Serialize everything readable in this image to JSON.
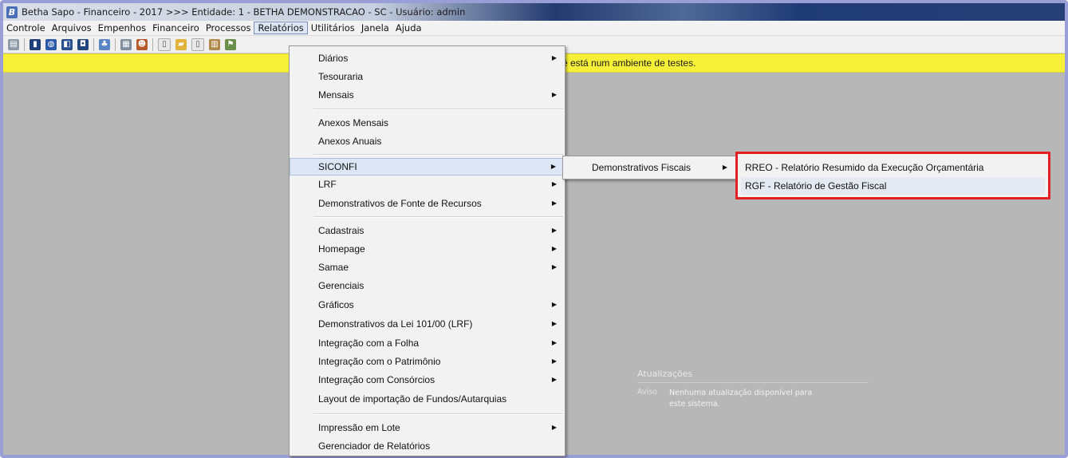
{
  "window": {
    "title": "Betha Sapo - Financeiro - 2017 >>> Entidade: 1 - BETHA DEMONSTRACAO - SC - Usuário: admin",
    "app_icon_letter": "B"
  },
  "menubar": {
    "items": [
      "Controle",
      "Arquivos",
      "Empenhos",
      "Financeiro",
      "Processos",
      "Relatórios",
      "Utilitários",
      "Janela",
      "Ajuda"
    ],
    "active": "Relatórios"
  },
  "toolbar": {
    "buttons": [
      "report-icon",
      "book-icon",
      "globe-icon",
      "chart-icon",
      "database-icon",
      "network-icon",
      "printer-icon",
      "user-icon",
      "document-icon",
      "folder-icon",
      "page-icon",
      "table-icon",
      "flag-icon"
    ]
  },
  "warning": {
    "text": "ê está num ambiente de testes."
  },
  "updates": {
    "title": "Atualizações",
    "label": "Aviso",
    "message": "Nenhuma atualização disponível para este sistema."
  },
  "relatorios_menu": {
    "items": [
      {
        "label": "Diários",
        "submenu": true
      },
      {
        "label": "Tesouraria",
        "submenu": false
      },
      {
        "label": "Mensais",
        "submenu": true
      },
      {
        "label": "Anexos Mensais",
        "submenu": false
      },
      {
        "label": "Anexos Anuais",
        "submenu": false
      },
      {
        "label": "SICONFI",
        "submenu": true,
        "highlighted": true
      },
      {
        "label": "LRF",
        "submenu": true
      },
      {
        "label": "Demonstrativos de Fonte de Recursos",
        "submenu": true
      },
      {
        "label": "Cadastrais",
        "submenu": true
      },
      {
        "label": "Homepage",
        "submenu": true
      },
      {
        "label": "Samae",
        "submenu": true
      },
      {
        "label": "Gerenciais",
        "submenu": false
      },
      {
        "label": "Gráficos",
        "submenu": true
      },
      {
        "label": "Demonstrativos da Lei 101/00 (LRF)",
        "submenu": true
      },
      {
        "label": "Integração com a Folha",
        "submenu": true
      },
      {
        "label": "Integração com o Patrimônio",
        "submenu": true
      },
      {
        "label": "Integração com Consórcios",
        "submenu": true
      },
      {
        "label": "Layout de importação de Fundos/Autarquias",
        "submenu": false
      },
      {
        "label": "Impressão em Lote",
        "submenu": true
      },
      {
        "label": "Gerenciador de Relatórios",
        "submenu": false
      }
    ]
  },
  "siconfi_menu": {
    "items": [
      {
        "label": "Demonstrativos Fiscais",
        "submenu": true
      }
    ]
  },
  "demonstrativos_menu": {
    "items": [
      {
        "label": "RREO - Relatório Resumido da Execução Orçamentária"
      },
      {
        "label": "RGF - Relatório de Gestão Fiscal"
      }
    ]
  },
  "colors": {
    "highlight_border": "#e31e24",
    "warning_bg": "#f7f039",
    "workspace_bg": "#b7b7b7"
  }
}
